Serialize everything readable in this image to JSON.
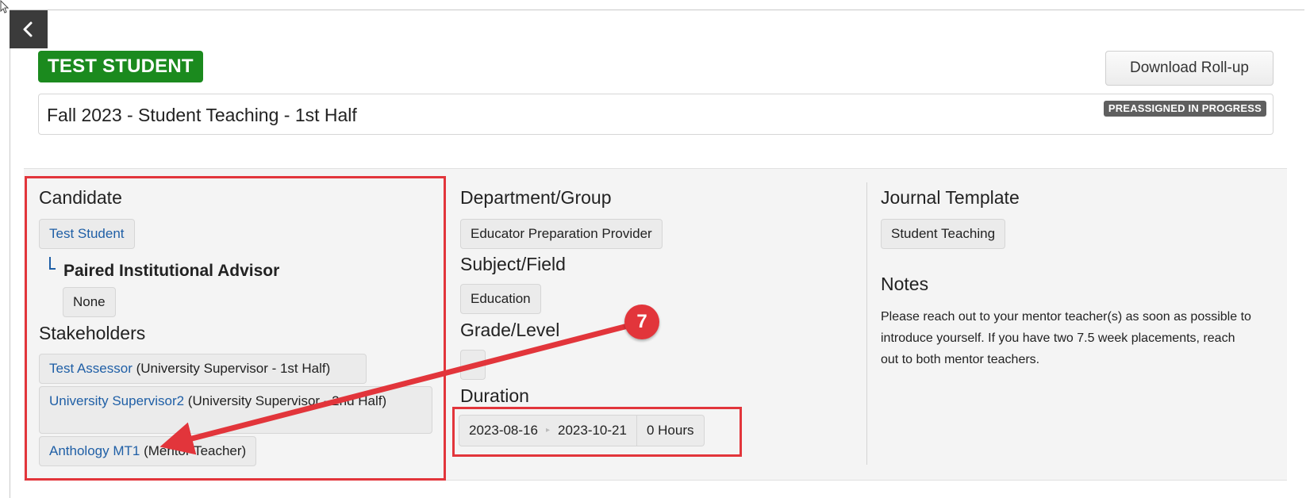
{
  "header": {
    "student_name": "TEST STUDENT",
    "download_label": "Download Roll-up"
  },
  "placement": {
    "title": "Fall 2023 - Student Teaching - 1st Half",
    "status": "PREASSIGNED IN PROGRESS"
  },
  "candidate": {
    "heading": "Candidate",
    "name": "Test Student",
    "advisor_heading": "Paired Institutional Advisor",
    "advisor_value": "None"
  },
  "stakeholders": {
    "heading": "Stakeholders",
    "items": [
      {
        "name": "Test Assessor",
        "role": "(University Supervisor - 1st Half)"
      },
      {
        "name": "University Supervisor2",
        "role": "(University Supervisor - 2nd Half)"
      },
      {
        "name": "Anthology MT1",
        "role": "(Mentor Teacher)"
      }
    ]
  },
  "department": {
    "heading": "Department/Group",
    "value": "Educator Preparation Provider"
  },
  "subject": {
    "heading": "Subject/Field",
    "value": "Education"
  },
  "grade": {
    "heading": "Grade/Level",
    "value": "-"
  },
  "duration": {
    "heading": "Duration",
    "start": "2023-08-16",
    "end": "2023-10-21",
    "hours": "0 Hours"
  },
  "journal": {
    "heading": "Journal Template",
    "value": "Student Teaching"
  },
  "notes": {
    "heading": "Notes",
    "text": "Please reach out to your mentor teacher(s) as soon as possible to introduce yourself. If you have two 7.5 week placements, reach out to both mentor teachers."
  },
  "annotation": {
    "number": "7",
    "color": "#e2353b"
  },
  "colors": {
    "student_badge": "#1b8a1e",
    "status_badge": "#5f5f5f",
    "link": "#1f5fa6"
  },
  "icons": {
    "back": "chevron-left-icon",
    "duration_separator": "arrow-right-icon"
  }
}
